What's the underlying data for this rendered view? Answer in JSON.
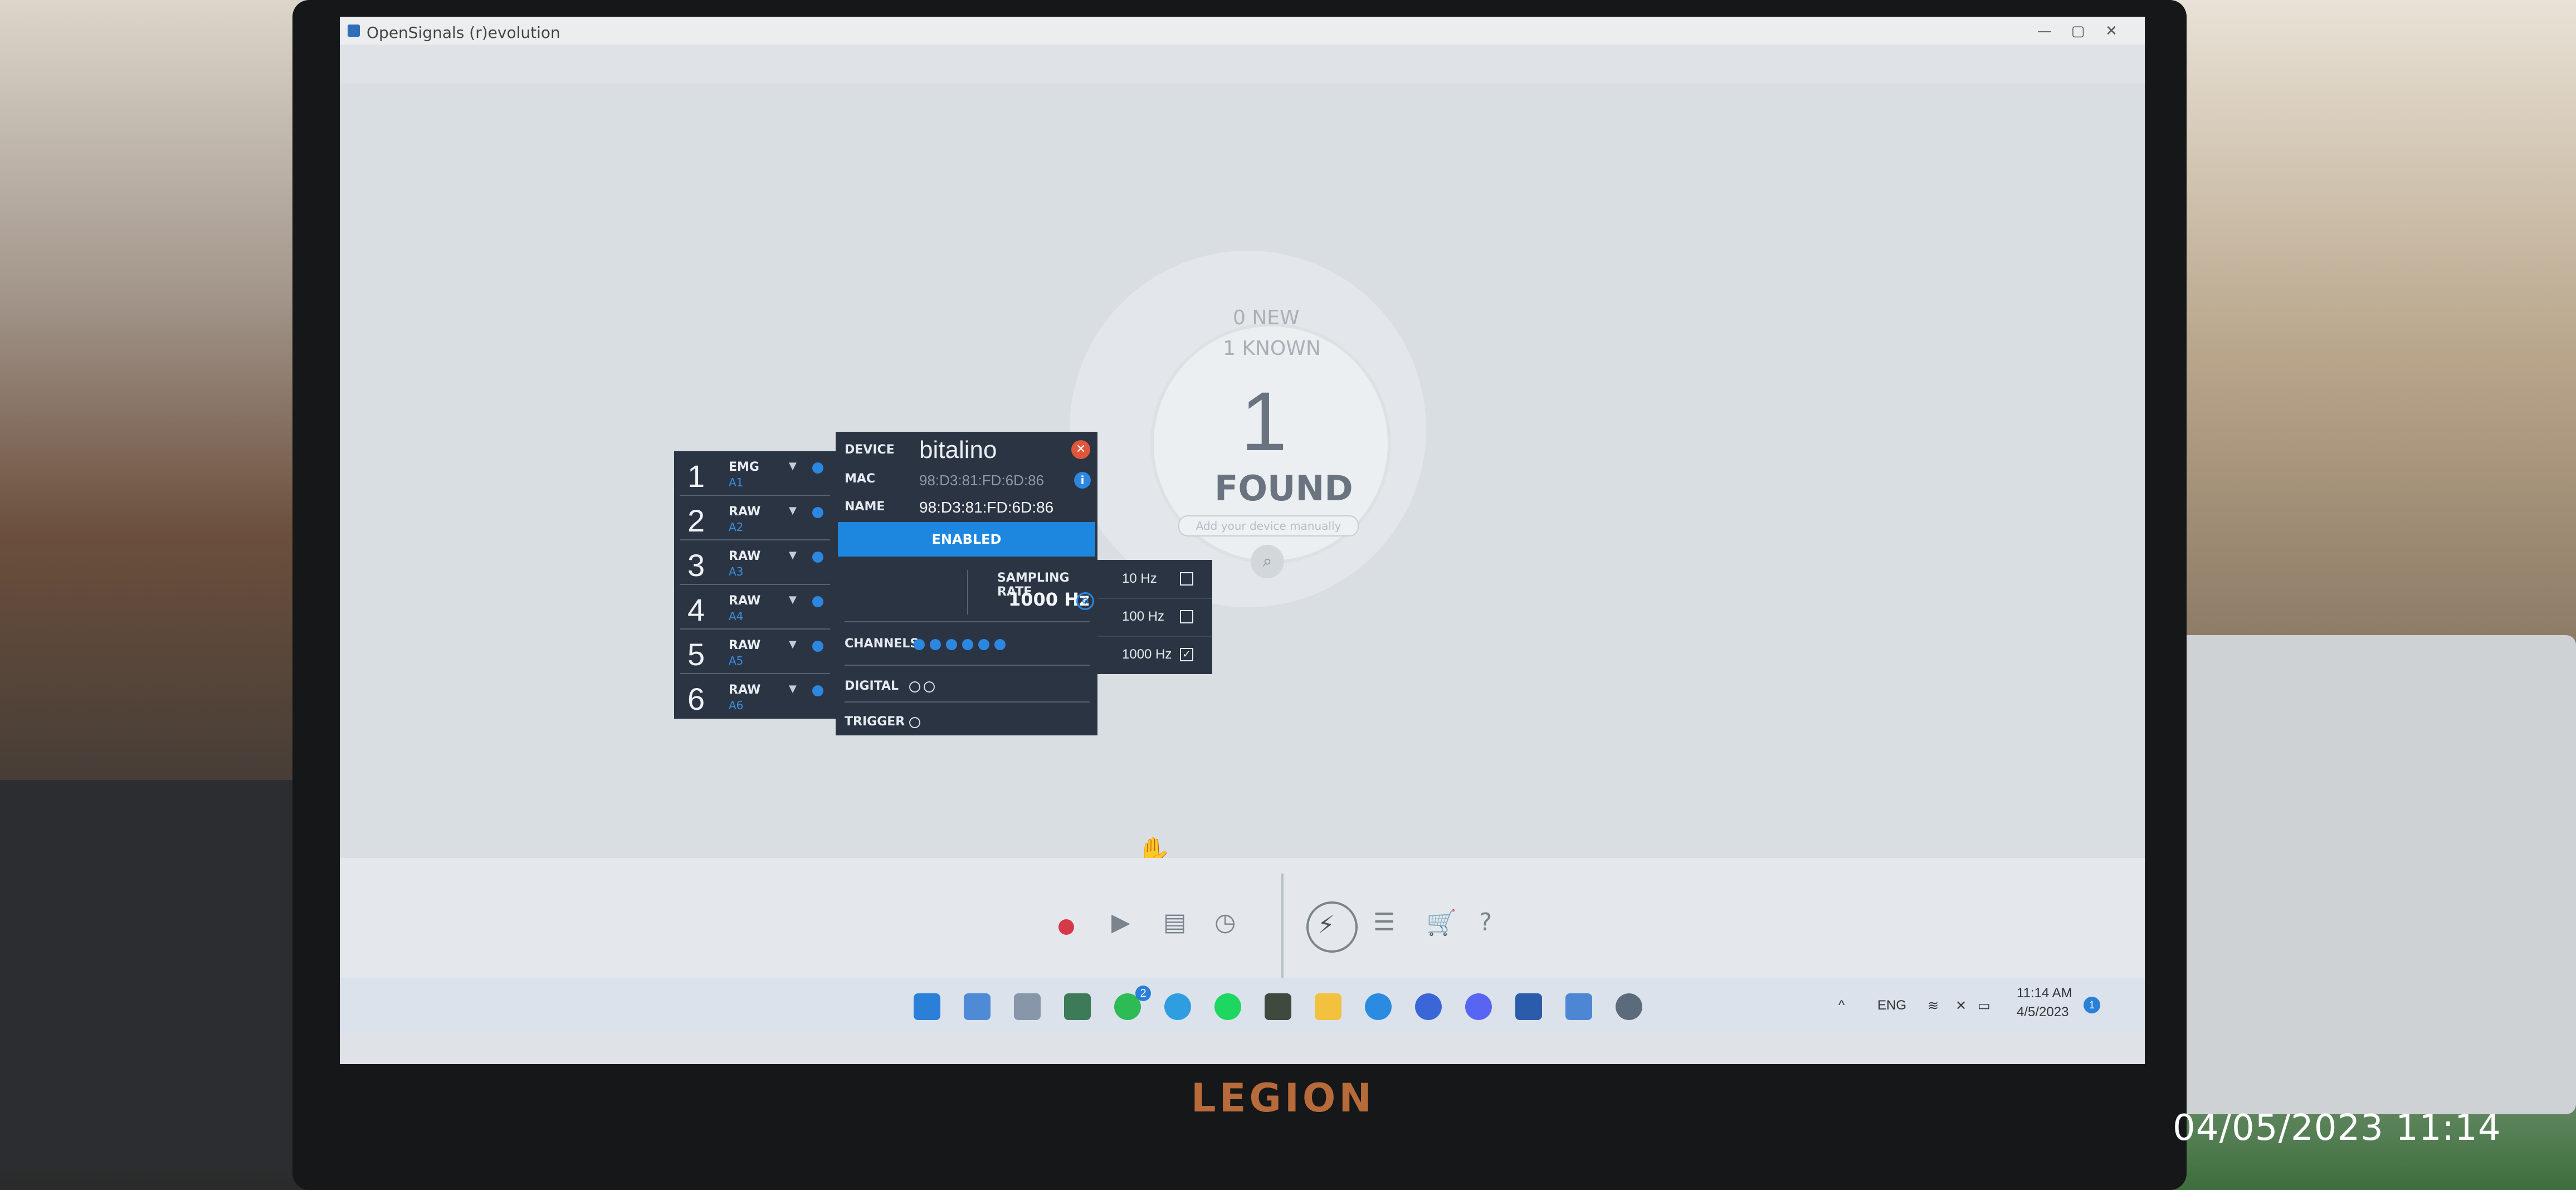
{
  "window": {
    "title": "OpenSignals (r)evolution",
    "controls": {
      "minimize": "—",
      "maximize": "▢",
      "close": "✕"
    }
  },
  "discovery": {
    "new_label": "0 NEW",
    "known_label": "1 KNOWN",
    "found_count": "1",
    "found_label": "FOUND",
    "manual_placeholder": "Add your device manually"
  },
  "channels": [
    {
      "num": "1",
      "type": "EMG",
      "source": "A1"
    },
    {
      "num": "2",
      "type": "RAW",
      "source": "A2"
    },
    {
      "num": "3",
      "type": "RAW",
      "source": "A3"
    },
    {
      "num": "4",
      "type": "RAW",
      "source": "A4"
    },
    {
      "num": "5",
      "type": "RAW",
      "source": "A5"
    },
    {
      "num": "6",
      "type": "RAW",
      "source": "A6"
    }
  ],
  "device": {
    "device_label": "DEVICE",
    "logo_text": "bitalino",
    "mac_label": "MAC",
    "mac_value": "98:D3:81:FD:6D:86",
    "name_label": "NAME",
    "name_value": "98:D3:81:FD:6D:86",
    "status": "ENABLED",
    "sampling_label": "SAMPLING RATE",
    "sampling_value": "1000 Hz",
    "channels_label": "CHANNELS",
    "digital_label": "DIGITAL",
    "trigger_label": "TRIGGER"
  },
  "sampling_options": [
    {
      "label": "10 Hz",
      "checked": false
    },
    {
      "label": "100 Hz",
      "checked": false
    },
    {
      "label": "1000 Hz",
      "checked": true
    }
  ],
  "toolbar": {
    "record_icon": "record-icon",
    "play_icon": "play-icon",
    "save_icon": "save-icon",
    "clock_icon": "clock-icon",
    "help": "?"
  },
  "taskbar": {
    "whatsapp_badge": "2",
    "language": "ENG",
    "time": "11:14 AM",
    "date": "4/5/2023",
    "notification_count": "1"
  },
  "laptop_brand": "LEGION",
  "photo_timestamp": "04/05/2023 11:14",
  "colors": {
    "accent": "#1d87df",
    "panel": "#2b3443",
    "record": "#d6394a",
    "bitalino_green": "#9fd04a"
  }
}
